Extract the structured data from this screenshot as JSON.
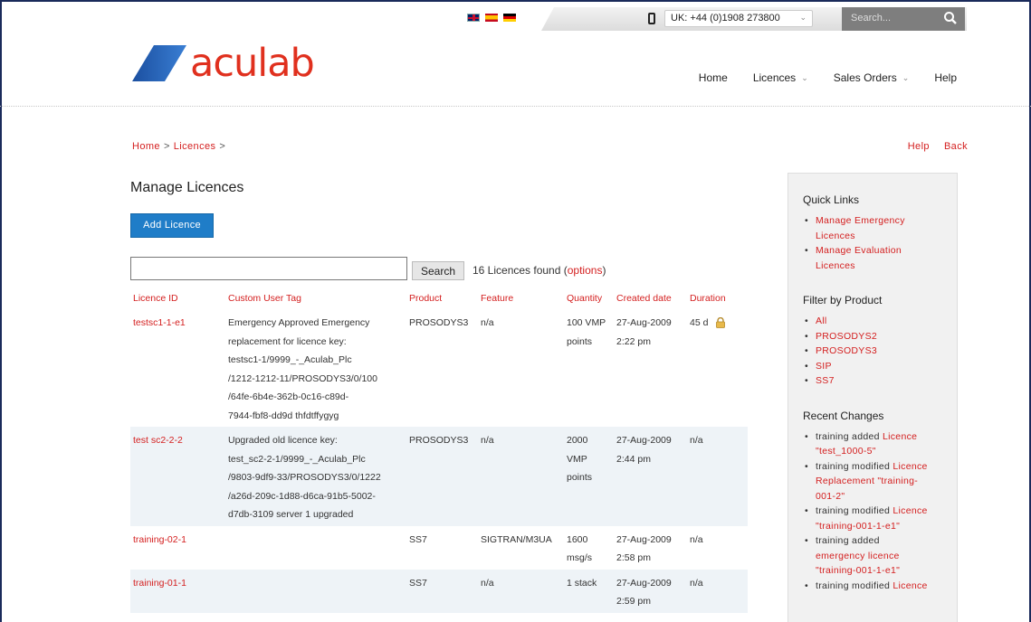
{
  "topbar": {
    "flags": [
      "uk-flag-icon",
      "spain-flag-icon",
      "germany-flag-icon"
    ],
    "phone_selected": "UK: +44 (0)1908 273800",
    "search_placeholder": "Search..."
  },
  "logo": {
    "text": "aculab"
  },
  "nav": {
    "home": "Home",
    "licences": "Licences",
    "sales_orders": "Sales Orders",
    "help": "Help"
  },
  "breadcrumb": {
    "home": "Home",
    "sep1": ">",
    "licences": "Licences",
    "sep2": ">"
  },
  "toplinks": {
    "help": "Help",
    "back": "Back"
  },
  "page": {
    "title": "Manage Licences",
    "add_button": "Add Licence",
    "search_value": "",
    "search_button": "Search",
    "found_text": "16 Licences found (",
    "options_link": "options",
    "found_close": ")"
  },
  "table": {
    "headers": [
      "Licence ID",
      "Custom User Tag",
      "Product",
      "Feature",
      "Quantity",
      "Created date",
      "Duration"
    ],
    "rows": [
      {
        "id": "testsc1-1-e1",
        "tag_lines": [
          "Emergency Approved Emergency",
          "replacement for licence key:",
          "testsc1-1/9999_-_Aculab_Plc",
          "/1212-1212-11/PROSODYS3/0/100",
          "/64fe-6b4e-362b-0c16-c89d-",
          "7944-fbf8-dd9d thfdtffygyg"
        ],
        "product": "PROSODYS3",
        "feature": "n/a",
        "quantity_lines": [
          "100 VMP",
          "points"
        ],
        "date_lines": [
          "27-Aug-2009",
          "2:22 pm"
        ],
        "duration": "45 d",
        "locked": true
      },
      {
        "id": "test sc2-2-2",
        "tag_lines": [
          "Upgraded old licence key:",
          "test_sc2-2-1/9999_-_Aculab_Plc",
          "/9803-9df9-33/PROSODYS3/0/1222",
          "/a26d-209c-1d88-d6ca-91b5-5002-",
          "d7db-3109 server 1 upgraded"
        ],
        "product": "PROSODYS3",
        "feature": "n/a",
        "quantity_lines": [
          "2000",
          "VMP",
          "points"
        ],
        "date_lines": [
          "27-Aug-2009",
          "2:44 pm"
        ],
        "duration": "n/a",
        "locked": false
      },
      {
        "id": "training-02-1",
        "tag_lines": [],
        "product": "SS7",
        "feature": "SIGTRAN/M3UA",
        "quantity_lines": [
          "1600",
          "msg/s"
        ],
        "date_lines": [
          "27-Aug-2009",
          "2:58 pm"
        ],
        "duration": "n/a",
        "locked": false
      },
      {
        "id": "training-01-1",
        "tag_lines": [],
        "product": "SS7",
        "feature": "n/a",
        "quantity_lines": [
          "1 stack"
        ],
        "date_lines": [
          "27-Aug-2009",
          "2:59 pm"
        ],
        "duration": "n/a",
        "locked": false
      }
    ]
  },
  "sidebar": {
    "quick_links_title": "Quick Links",
    "quick_links": [
      [
        "Manage Emergency",
        "Licences"
      ],
      [
        "Manage Evaluation",
        "Licences"
      ]
    ],
    "filter_title": "Filter by Product",
    "filters": [
      "All",
      "PROSODYS2",
      "PROSODYS3",
      "SIP",
      "SS7"
    ],
    "recent_title": "Recent Changes",
    "recent": [
      {
        "lines": [
          [
            "training added ",
            ""
          ],
          [
            "Licence",
            "red"
          ],
          [
            "\"test_1000-5\"",
            "red"
          ]
        ]
      },
      {
        "lines": [
          [
            "training modified ",
            ""
          ],
          [
            "Licence",
            "red"
          ],
          [
            "Replacement \"training-",
            "red"
          ],
          [
            "001-2\"",
            "red"
          ]
        ]
      },
      {
        "lines": [
          [
            "training modified ",
            ""
          ],
          [
            "Licence",
            "red"
          ],
          [
            "\"training-001-1-e1\"",
            "red"
          ]
        ]
      },
      {
        "lines": [
          [
            "training added",
            ""
          ],
          [
            "emergency licence",
            "red"
          ],
          [
            "\"training-001-1-e1\"",
            "red"
          ]
        ]
      },
      {
        "lines": [
          [
            "training modified ",
            ""
          ],
          [
            "Licence",
            "red"
          ]
        ]
      }
    ]
  },
  "colors": {
    "accent_red": "#d42020",
    "button_blue": "#1f7dc8",
    "row_alt": "#eef3f7"
  }
}
